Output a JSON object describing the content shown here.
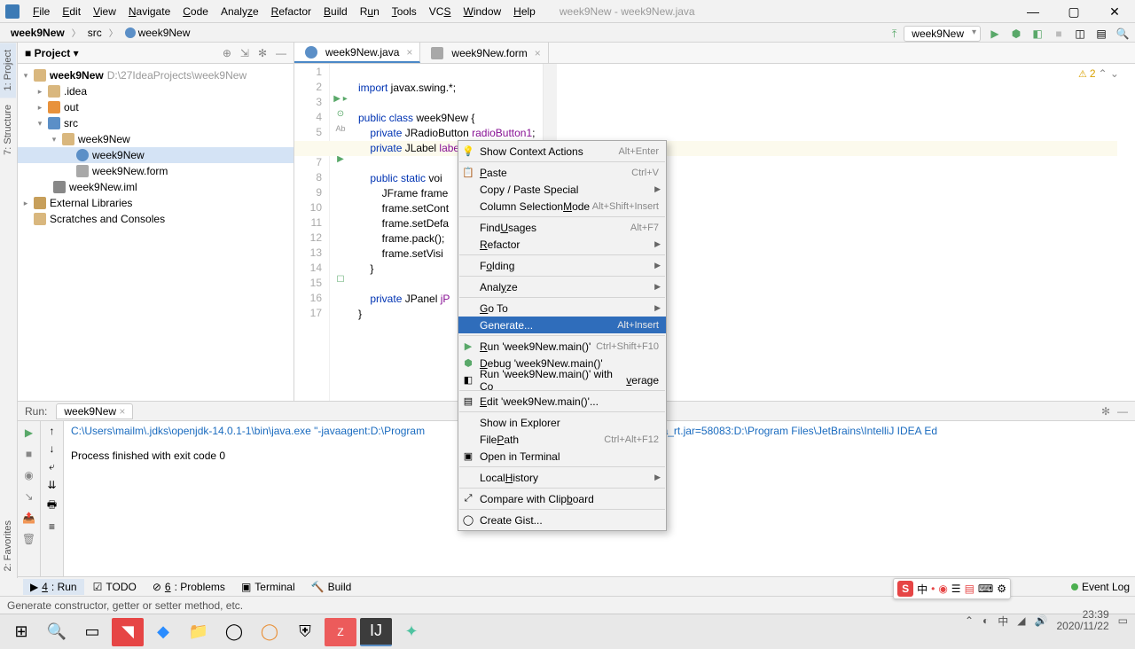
{
  "window": {
    "title": "week9New - week9New.java"
  },
  "menubar": [
    "File",
    "Edit",
    "View",
    "Navigate",
    "Code",
    "Analyze",
    "Refactor",
    "Build",
    "Run",
    "Tools",
    "VCS",
    "Window",
    "Help"
  ],
  "breadcrumb": {
    "items": [
      "week9New",
      "src",
      "week9New"
    ]
  },
  "run_config": {
    "selected": "week9New"
  },
  "left_tabs": [
    "1: Project",
    "7: Structure",
    "2: Favorites"
  ],
  "project_panel": {
    "title": "Project",
    "tree": {
      "root": {
        "name": "week9New",
        "path": "D:\\27IdeaProjects\\week9New"
      },
      "idea": ".idea",
      "out": "out",
      "src": "src",
      "pkg": "week9New",
      "class": "week9New",
      "form": "week9New.form",
      "iml": "week9New.iml",
      "ext": "External Libraries",
      "scratch": "Scratches and Consoles"
    }
  },
  "editor_tabs": [
    {
      "name": "week9New.java",
      "active": true
    },
    {
      "name": "week9New.form",
      "active": false
    }
  ],
  "inspection": {
    "warnings": "2"
  },
  "code_lines": [
    "import javax.swing.*;",
    "",
    "public class week9New {",
    "    private JRadioButton radioButton1;",
    "    private JLabel label1;",
    "",
    "    public static voi",
    "        JFrame frame",
    "        frame.setCont",
    "        frame.setDefa",
    "        frame.pack();",
    "        frame.setVisi",
    "    }",
    "",
    "    private JPanel jP",
    "}",
    ""
  ],
  "context_menu": {
    "items": [
      {
        "label": "Show Context Actions",
        "shortcut": "Alt+Enter",
        "icon": "bulb"
      },
      {
        "sep": true
      },
      {
        "label": "Paste",
        "shortcut": "Ctrl+V",
        "icon": "paste"
      },
      {
        "label": "Copy / Paste Special",
        "submenu": true
      },
      {
        "label": "Column Selection Mode",
        "shortcut": "Alt+Shift+Insert"
      },
      {
        "sep": true
      },
      {
        "label": "Find Usages",
        "shortcut": "Alt+F7"
      },
      {
        "label": "Refactor",
        "submenu": true
      },
      {
        "sep": true
      },
      {
        "label": "Folding",
        "submenu": true
      },
      {
        "sep": true
      },
      {
        "label": "Analyze",
        "submenu": true
      },
      {
        "sep": true
      },
      {
        "label": "Go To",
        "submenu": true
      },
      {
        "label": "Generate...",
        "shortcut": "Alt+Insert",
        "highlighted": true
      },
      {
        "sep": true
      },
      {
        "label": "Run 'week9New.main()'",
        "shortcut": "Ctrl+Shift+F10",
        "icon": "play"
      },
      {
        "label": "Debug 'week9New.main()'",
        "icon": "bug"
      },
      {
        "label": "Run 'week9New.main()' with Coverage",
        "icon": "coverage"
      },
      {
        "sep": true
      },
      {
        "label": "Edit 'week9New.main()'...",
        "icon": "edit"
      },
      {
        "sep": true
      },
      {
        "label": "Show in Explorer"
      },
      {
        "label": "File Path",
        "shortcut": "Ctrl+Alt+F12"
      },
      {
        "label": "Open in Terminal",
        "icon": "terminal"
      },
      {
        "sep": true
      },
      {
        "label": "Local History",
        "submenu": true
      },
      {
        "sep": true
      },
      {
        "label": "Compare with Clipboard",
        "icon": "diff"
      },
      {
        "sep": true
      },
      {
        "label": "Create Gist...",
        "icon": "github"
      }
    ]
  },
  "run_panel": {
    "label": "Run:",
    "tab": "week9New",
    "output_line1": "C:\\Users\\mailm\\.jdks\\openjdk-14.0.1-1\\bin\\java.exe \"-javaagent:D:\\Program",
    "output_line1_tail": "al Edition 2020.1.1\\lib\\idea_rt.jar=58083:D:\\Program Files\\JetBrains\\IntelliJ IDEA Ed",
    "output_line2": "",
    "output_line3": "Process finished with exit code 0"
  },
  "bottom_tabs": {
    "run": "4: Run",
    "todo": "TODO",
    "problems": "6: Problems",
    "terminal": "Terminal",
    "build": "Build",
    "event_log": "Event Log"
  },
  "status_bar": {
    "hint": "Generate constructor, getter or setter method, etc."
  },
  "sogou_bar": {
    "chars": [
      "中",
      "•",
      "◉",
      "☰",
      "▤",
      "⌨",
      "⚙"
    ]
  },
  "tray": {
    "time": "23:39",
    "date": "2020/11/22"
  }
}
